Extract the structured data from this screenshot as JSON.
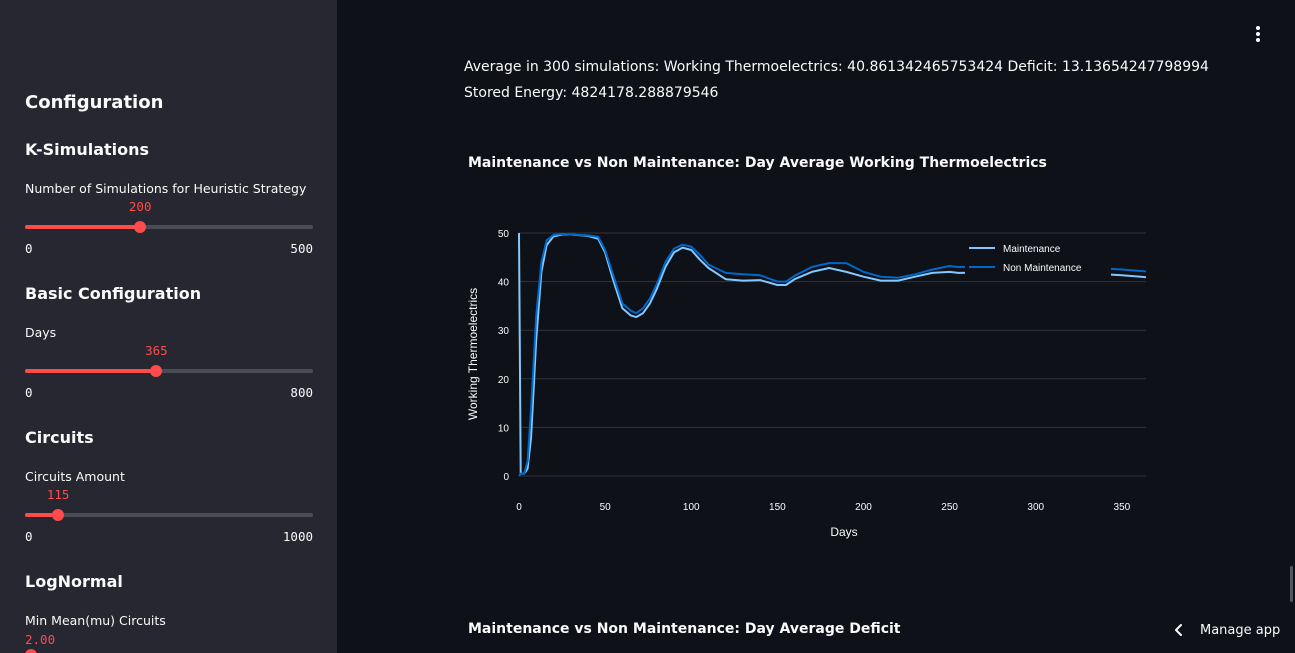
{
  "sidebar": {
    "title": "Configuration",
    "sections": {
      "ksim": {
        "heading": "K-Simulations",
        "slider_label": "Number of Simulations for Heuristic Strategy",
        "value": "200",
        "min": "0",
        "max": "500",
        "fraction": 0.4
      },
      "basic": {
        "heading": "Basic Configuration",
        "slider_label": "Days",
        "value": "365",
        "min": "0",
        "max": "800",
        "fraction": 0.45625
      },
      "circuits": {
        "heading": "Circuits",
        "slider_label": "Circuits Amount",
        "value": "115",
        "min": "0",
        "max": "1000",
        "fraction": 0.115
      },
      "lognormal": {
        "heading": "LogNormal",
        "field_label": "Min Mean(mu) Circuits",
        "value": "2.00"
      }
    }
  },
  "main": {
    "summary_line1": "Average in 300 simulations: Working Thermoelectrics: 40.861342465753424 Deficit: 13.13654247798994",
    "summary_line2": "Stored Energy: 4824178.288879546",
    "chart1_title": "Maintenance vs Non Maintenance: Day Average Working Thermoelectrics",
    "chart2_title": "Maintenance vs Non Maintenance: Day Average Deficit",
    "manage_app": "Manage app"
  },
  "colors": {
    "accent": "#ff4b4b",
    "series_maintenance": "#83c9ff",
    "series_non_maintenance": "#0068c9"
  },
  "chart_data": {
    "type": "line",
    "title": "Maintenance vs Non Maintenance: Day Average Working Thermoelectrics",
    "xlabel": "Days",
    "ylabel": "Working Thermoelectrics",
    "xlim": [
      0,
      364
    ],
    "ylim": [
      0,
      50
    ],
    "xticks": [
      0,
      50,
      100,
      150,
      200,
      250,
      300,
      350
    ],
    "yticks": [
      0,
      10,
      20,
      30,
      40,
      50
    ],
    "grid": true,
    "legend_position": "top-right",
    "series": [
      {
        "name": "Maintenance",
        "x": [
          0,
          1,
          3,
          5,
          7,
          10,
          13,
          16,
          20,
          25,
          30,
          40,
          46,
          50,
          55,
          60,
          65,
          68,
          72,
          76,
          80,
          85,
          90,
          95,
          100,
          105,
          110,
          120,
          130,
          140,
          150,
          155,
          160,
          170,
          180,
          190,
          200,
          210,
          220,
          230,
          240,
          250,
          255,
          330,
          340,
          350,
          364
        ],
        "y": [
          50,
          0.5,
          0.5,
          1.5,
          8,
          28,
          42,
          47.5,
          49.3,
          49.7,
          49.7,
          49.4,
          48.8,
          46,
          40,
          34.5,
          33,
          32.7,
          33.5,
          35.5,
          38.5,
          43,
          46,
          47,
          46.5,
          44.5,
          42.8,
          40.5,
          40.2,
          40.3,
          39.3,
          39.3,
          40.5,
          42,
          42.8,
          42,
          41,
          40.2,
          40.2,
          41,
          41.8,
          42,
          41.8,
          42,
          41.5,
          41.3,
          40.9
        ]
      },
      {
        "name": "Non Maintenance",
        "x": [
          0,
          1,
          3,
          5,
          7,
          10,
          13,
          16,
          20,
          25,
          30,
          40,
          46,
          50,
          55,
          60,
          65,
          68,
          72,
          76,
          80,
          85,
          90,
          95,
          100,
          105,
          110,
          120,
          130,
          140,
          150,
          155,
          160,
          170,
          180,
          190,
          200,
          210,
          220,
          230,
          240,
          250,
          255,
          330,
          340,
          350,
          364
        ],
        "y": [
          0,
          0.5,
          0.5,
          3,
          14,
          33,
          44,
          48.5,
          49.6,
          49.8,
          49.7,
          49.5,
          49.2,
          46.5,
          41,
          35.5,
          34,
          33.5,
          34.5,
          36.5,
          39.5,
          44,
          46.8,
          47.6,
          47.2,
          45.5,
          43.5,
          41.8,
          41.5,
          41.3,
          40,
          40,
          41.2,
          43,
          43.8,
          43.8,
          42,
          41,
          40.8,
          41.5,
          42.5,
          43.2,
          43,
          43,
          42.7,
          42.5,
          42.1
        ]
      }
    ]
  }
}
